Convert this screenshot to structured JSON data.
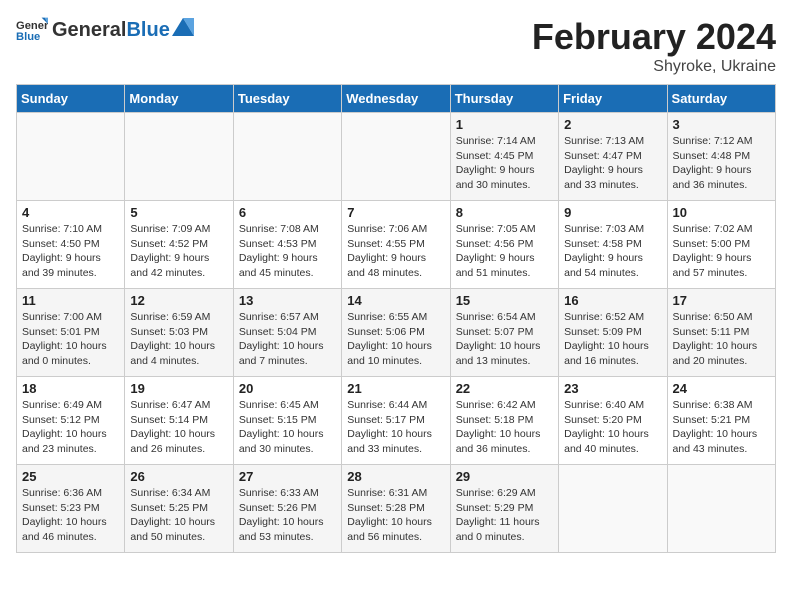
{
  "header": {
    "logo_general": "General",
    "logo_blue": "Blue",
    "title": "February 2024",
    "subtitle": "Shyroke, Ukraine"
  },
  "weekdays": [
    "Sunday",
    "Monday",
    "Tuesday",
    "Wednesday",
    "Thursday",
    "Friday",
    "Saturday"
  ],
  "weeks": [
    [
      {
        "day": "",
        "info": ""
      },
      {
        "day": "",
        "info": ""
      },
      {
        "day": "",
        "info": ""
      },
      {
        "day": "",
        "info": ""
      },
      {
        "day": "1",
        "info": "Sunrise: 7:14 AM\nSunset: 4:45 PM\nDaylight: 9 hours\nand 30 minutes."
      },
      {
        "day": "2",
        "info": "Sunrise: 7:13 AM\nSunset: 4:47 PM\nDaylight: 9 hours\nand 33 minutes."
      },
      {
        "day": "3",
        "info": "Sunrise: 7:12 AM\nSunset: 4:48 PM\nDaylight: 9 hours\nand 36 minutes."
      }
    ],
    [
      {
        "day": "4",
        "info": "Sunrise: 7:10 AM\nSunset: 4:50 PM\nDaylight: 9 hours\nand 39 minutes."
      },
      {
        "day": "5",
        "info": "Sunrise: 7:09 AM\nSunset: 4:52 PM\nDaylight: 9 hours\nand 42 minutes."
      },
      {
        "day": "6",
        "info": "Sunrise: 7:08 AM\nSunset: 4:53 PM\nDaylight: 9 hours\nand 45 minutes."
      },
      {
        "day": "7",
        "info": "Sunrise: 7:06 AM\nSunset: 4:55 PM\nDaylight: 9 hours\nand 48 minutes."
      },
      {
        "day": "8",
        "info": "Sunrise: 7:05 AM\nSunset: 4:56 PM\nDaylight: 9 hours\nand 51 minutes."
      },
      {
        "day": "9",
        "info": "Sunrise: 7:03 AM\nSunset: 4:58 PM\nDaylight: 9 hours\nand 54 minutes."
      },
      {
        "day": "10",
        "info": "Sunrise: 7:02 AM\nSunset: 5:00 PM\nDaylight: 9 hours\nand 57 minutes."
      }
    ],
    [
      {
        "day": "11",
        "info": "Sunrise: 7:00 AM\nSunset: 5:01 PM\nDaylight: 10 hours\nand 0 minutes."
      },
      {
        "day": "12",
        "info": "Sunrise: 6:59 AM\nSunset: 5:03 PM\nDaylight: 10 hours\nand 4 minutes."
      },
      {
        "day": "13",
        "info": "Sunrise: 6:57 AM\nSunset: 5:04 PM\nDaylight: 10 hours\nand 7 minutes."
      },
      {
        "day": "14",
        "info": "Sunrise: 6:55 AM\nSunset: 5:06 PM\nDaylight: 10 hours\nand 10 minutes."
      },
      {
        "day": "15",
        "info": "Sunrise: 6:54 AM\nSunset: 5:07 PM\nDaylight: 10 hours\nand 13 minutes."
      },
      {
        "day": "16",
        "info": "Sunrise: 6:52 AM\nSunset: 5:09 PM\nDaylight: 10 hours\nand 16 minutes."
      },
      {
        "day": "17",
        "info": "Sunrise: 6:50 AM\nSunset: 5:11 PM\nDaylight: 10 hours\nand 20 minutes."
      }
    ],
    [
      {
        "day": "18",
        "info": "Sunrise: 6:49 AM\nSunset: 5:12 PM\nDaylight: 10 hours\nand 23 minutes."
      },
      {
        "day": "19",
        "info": "Sunrise: 6:47 AM\nSunset: 5:14 PM\nDaylight: 10 hours\nand 26 minutes."
      },
      {
        "day": "20",
        "info": "Sunrise: 6:45 AM\nSunset: 5:15 PM\nDaylight: 10 hours\nand 30 minutes."
      },
      {
        "day": "21",
        "info": "Sunrise: 6:44 AM\nSunset: 5:17 PM\nDaylight: 10 hours\nand 33 minutes."
      },
      {
        "day": "22",
        "info": "Sunrise: 6:42 AM\nSunset: 5:18 PM\nDaylight: 10 hours\nand 36 minutes."
      },
      {
        "day": "23",
        "info": "Sunrise: 6:40 AM\nSunset: 5:20 PM\nDaylight: 10 hours\nand 40 minutes."
      },
      {
        "day": "24",
        "info": "Sunrise: 6:38 AM\nSunset: 5:21 PM\nDaylight: 10 hours\nand 43 minutes."
      }
    ],
    [
      {
        "day": "25",
        "info": "Sunrise: 6:36 AM\nSunset: 5:23 PM\nDaylight: 10 hours\nand 46 minutes."
      },
      {
        "day": "26",
        "info": "Sunrise: 6:34 AM\nSunset: 5:25 PM\nDaylight: 10 hours\nand 50 minutes."
      },
      {
        "day": "27",
        "info": "Sunrise: 6:33 AM\nSunset: 5:26 PM\nDaylight: 10 hours\nand 53 minutes."
      },
      {
        "day": "28",
        "info": "Sunrise: 6:31 AM\nSunset: 5:28 PM\nDaylight: 10 hours\nand 56 minutes."
      },
      {
        "day": "29",
        "info": "Sunrise: 6:29 AM\nSunset: 5:29 PM\nDaylight: 11 hours\nand 0 minutes."
      },
      {
        "day": "",
        "info": ""
      },
      {
        "day": "",
        "info": ""
      }
    ]
  ]
}
